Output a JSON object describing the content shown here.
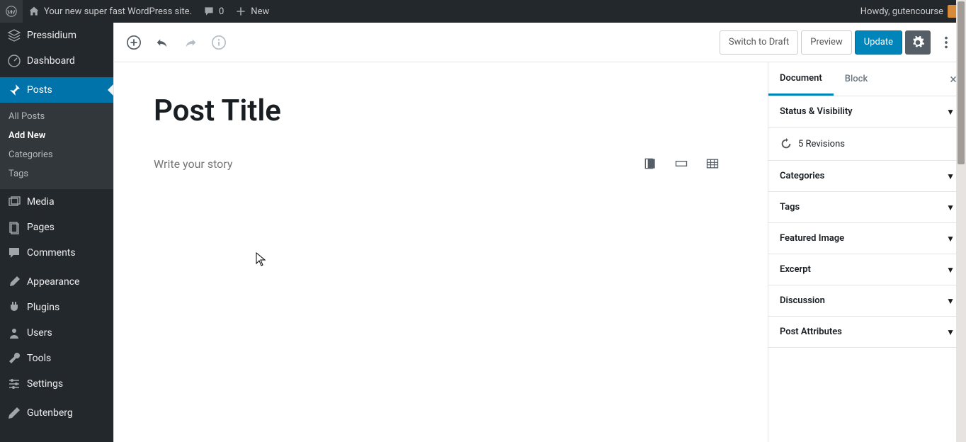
{
  "adminbar": {
    "site_name": "Your new super fast WordPress site.",
    "comments_count": "0",
    "new_label": "New",
    "howdy": "Howdy, gutencourse"
  },
  "sidebar": {
    "host": "Pressidium",
    "items": [
      {
        "label": "Dashboard"
      },
      {
        "label": "Posts"
      },
      {
        "label": "Media"
      },
      {
        "label": "Pages"
      },
      {
        "label": "Comments"
      },
      {
        "label": "Appearance"
      },
      {
        "label": "Plugins"
      },
      {
        "label": "Users"
      },
      {
        "label": "Tools"
      },
      {
        "label": "Settings"
      },
      {
        "label": "Gutenberg"
      }
    ],
    "posts_sub": [
      {
        "label": "All Posts"
      },
      {
        "label": "Add New"
      },
      {
        "label": "Categories"
      },
      {
        "label": "Tags"
      }
    ]
  },
  "toolbar": {
    "switch_draft": "Switch to Draft",
    "preview": "Preview",
    "update": "Update"
  },
  "editor": {
    "title_value": "Post Title",
    "story_placeholder": "Write your story"
  },
  "rpanel": {
    "tab_document": "Document",
    "tab_block": "Block",
    "sections": {
      "status": "Status & Visibility",
      "revisions": "5 Revisions",
      "categories": "Categories",
      "tags": "Tags",
      "featured": "Featured Image",
      "excerpt": "Excerpt",
      "discussion": "Discussion",
      "attributes": "Post Attributes"
    }
  }
}
